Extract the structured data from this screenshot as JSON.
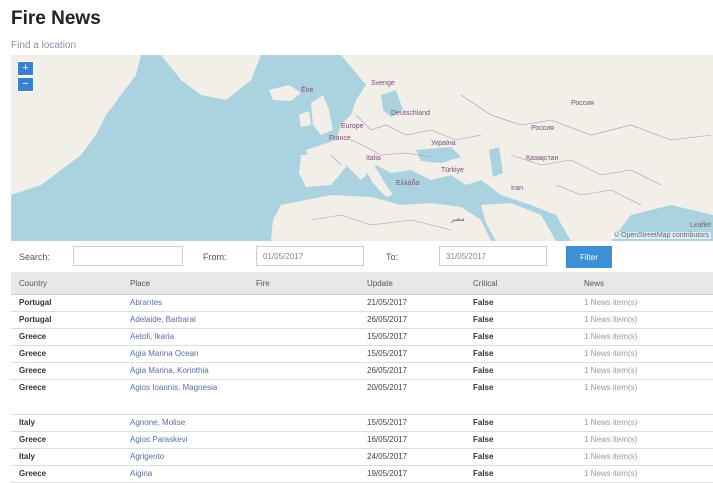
{
  "page": {
    "title": "Fire News",
    "find_location_link": "Find a location"
  },
  "map": {
    "zoom_in": "+",
    "zoom_out": "−",
    "attribution": "© OpenStreetMap contributors",
    "attribution2": "Leaflet",
    "labels": [
      "Éire",
      "Россия",
      "Россия",
      "Europe",
      "Türkiye",
      "Україна",
      "Қазақстан",
      "İran",
      "Ελλάδα",
      "مصر",
      "Sverige",
      "Deutschland",
      "France",
      "Italia"
    ],
    "colors": {
      "water": "#aad3df",
      "land": "#f2efe9",
      "border": "#b58db5"
    }
  },
  "filters": {
    "search_label": "Search:",
    "search_value": "",
    "from_label": "From:",
    "from_value": "01/05/2017",
    "to_label": "To:",
    "to_value": "31/05/2017",
    "button_label": "Filter"
  },
  "table": {
    "columns": [
      "Country",
      "Place",
      "Fire",
      "Update",
      "Critical",
      "News"
    ],
    "rows": [
      [
        "Portugal",
        "Abrantes",
        "",
        "21/05/2017",
        "False",
        "1 News item(s)"
      ],
      [
        "Portugal",
        "Adelaide, Barbaral",
        "",
        "26/05/2017",
        "False",
        "1 News item(s)"
      ],
      [
        "Greece",
        "Aetoli, Ikaria",
        "",
        "15/05/2017",
        "False",
        "1 News item(s)"
      ],
      [
        "Greece",
        "Agia Marina Ocean",
        "",
        "15/05/2017",
        "False",
        "1 News item(s)"
      ],
      [
        "Greece",
        "Agia Marina, Korinthia",
        "",
        "26/05/2017",
        "False",
        "1 News item(s)"
      ],
      [
        "Greece",
        "Agios Ioannis, Magnesia",
        "",
        "20/05/2017",
        "False",
        "1 News item(s)"
      ],
      [
        "Italy",
        "Agnone, Molise",
        "",
        "15/05/2017",
        "False",
        "1 News item(s)"
      ],
      [
        "Greece",
        "Agios Paraskevi",
        "",
        "16/05/2017",
        "False",
        "1 News item(s)"
      ],
      [
        "Italy",
        "Agrigento",
        "",
        "24/05/2017",
        "False",
        "1 News item(s)"
      ],
      [
        "Greece",
        "Aigina",
        "",
        "19/05/2017",
        "False",
        "1 News item(s)"
      ]
    ]
  }
}
